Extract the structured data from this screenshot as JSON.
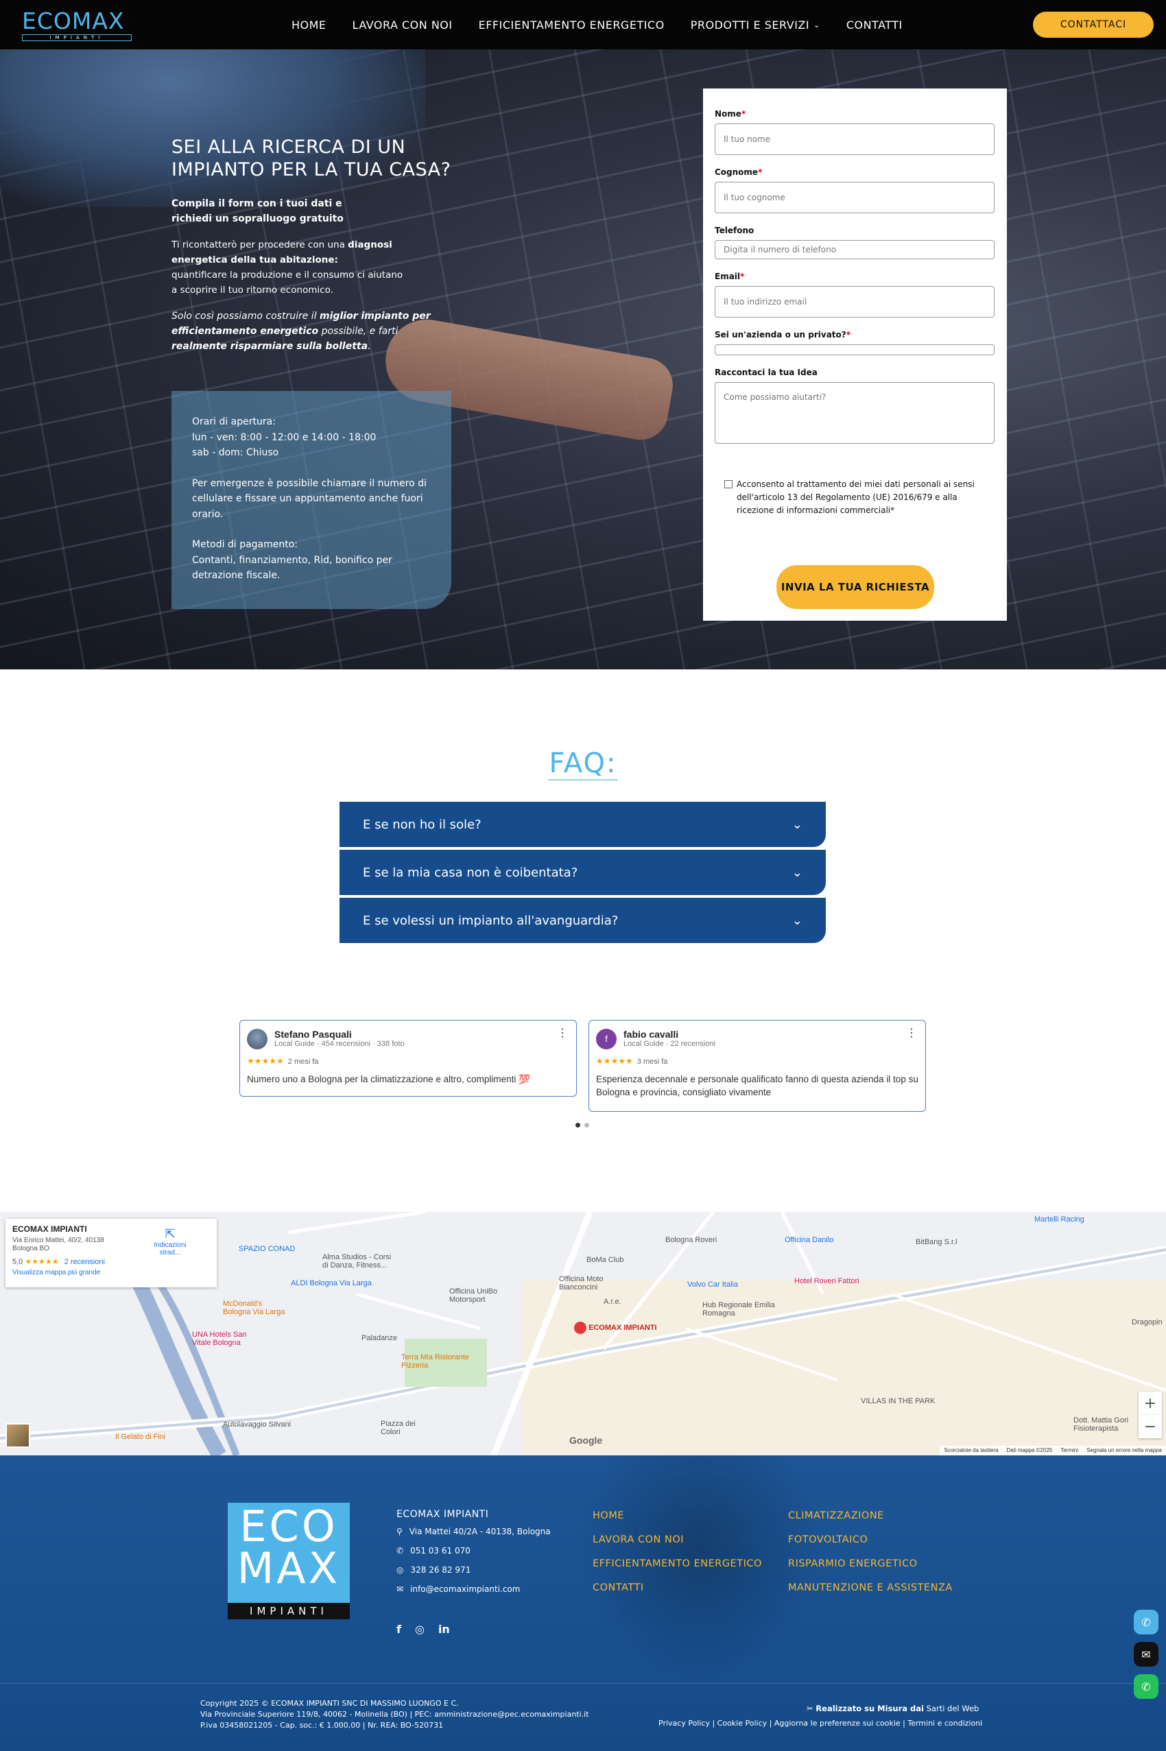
{
  "header": {
    "logo_text": "ECOMAX",
    "logo_sub": "IMPIANTI",
    "nav": [
      "HOME",
      "LAVORA CON NOI",
      "EFFICIENTAMENTO ENERGETICO",
      "PRODOTTI E SERVIZI",
      "CONTATTI"
    ],
    "cta": "CONTATTACI"
  },
  "hero": {
    "title": "SEI ALLA RICERCA DI UN IMPIANTO PER LA TUA CASA?",
    "p1": "Compila il form con i tuoi dati e richiedi un sopralluogo gratuito",
    "p2_a": "Ti ricontatterò per procedere con una ",
    "p2_b": "diagnosi energetica della tua abitazione:",
    "p2_c": "quantificare la produzione e il consumo ci aiutano a scoprire il tuo ritorno economico.",
    "p3_a": "Solo così possiamo costruire il ",
    "p3_b": "miglior impianto per efficientamento energetico",
    "p3_c": " possibile, e farti ",
    "p3_d": "realmente risparmiare sulla bolletta",
    "p3_e": ".",
    "hours_1": "Orari di apertura:",
    "hours_2": "lun - ven: 8:00 - 12:00 e 14:00 - 18:00",
    "hours_3": "sab - dom: Chiuso",
    "hours_4": "Per emergenze è possibile chiamare il numero di cellulare e fissare un appuntamento anche fuori orario.",
    "hours_5": "Metodi di pagamento:",
    "hours_6": "Contanti, finanziamento, Rid, bonifico per detrazione fiscale."
  },
  "form": {
    "nome_label": "Nome",
    "nome_ph": "Il tuo nome",
    "cognome_label": "Cognome",
    "cognome_ph": "Il tuo cognome",
    "tel_label": "Telefono",
    "tel_ph": "Digita il numero di telefono",
    "email_label": "Email",
    "email_ph": "Il tuo indirizzo email",
    "tipo_label": "Sei un'azienda o un privato?",
    "idea_label": "Raccontaci la tua Idea",
    "idea_ph": "Come possiamo aiutarti?",
    "consent": "Acconsento al trattamento dei miei dati personali ai sensi dell'articolo 13 del Regolamento (UE) 2016/679 e alla ricezione di informazioni commerciali*",
    "submit": "INVIA LA TUA RICHIESTA",
    "required_mark": "*"
  },
  "faq": {
    "title": "FAQ:",
    "items": [
      "E se non ho il sole?",
      "E se la mia casa non è coibentata?",
      "E se volessi un impianto all'avanguardia?"
    ]
  },
  "reviews": [
    {
      "name": "Stefano Pasquali",
      "sub": "Local Guide · 454 recensioni · 338 foto",
      "when": "2 mesi fa",
      "text": "Numero uno a Bologna per la climatizzazione e altro, complimenti 💯"
    },
    {
      "name": "fabio cavalli",
      "sub": "Local Guide · 22 recensioni",
      "when": "3 mesi fa",
      "text": "Esperienza decennale e personale qualificato fanno di questa azienda il top su Bologna e provincia, consigliato vivamente"
    }
  ],
  "map": {
    "card_title": "ECOMAX IMPIANTI",
    "card_address": "Via Enrico Mattei, 40/2, 40138 Bologna BO",
    "rating": "5,0",
    "reviews_link": "2 recensioni",
    "bigger_map": "Visualizza mappa più grande",
    "directions": "Indicazioni strad...",
    "pin_label": "ECOMAX IMPIANTI",
    "labels": [
      "Bologna Roveri",
      "Officina Danilo",
      "BitBang S.r.l",
      "Martelli Racing",
      "SPAZIO CONAD",
      "Alma Studios - Corsi di Danza, Fitness...",
      "ALDI Bologna Via Larga",
      "Officina UniBo Motorsport",
      "Officina Moto Bianconcini",
      "BoMa Club",
      "A.r.e.",
      "Volvo Car Italia",
      "Hotel Roveri Fattori",
      "Hub Regionale Emilia Romagna",
      "McDonald's Bologna Via Larga",
      "UNA Hotels San Vitale Bologna",
      "Paladanze",
      "Terra Mia Ristorante Pizzeria",
      "Via Enrico Mattei",
      "VILLAS IN THE PARK",
      "Autolavaggio Silvani",
      "Piazza dei Colori",
      "Il Gelato di Fini",
      "Dott. Mattia Gori Fisioterapista",
      "Dragopin"
    ],
    "google": "Google",
    "attrib": [
      "Scorciatoie da tastiera",
      "Dati mappa ©2025",
      "Termini",
      "Segnala un errore nella mappa"
    ]
  },
  "footer": {
    "logo_eco": "ECO",
    "logo_max": "MAX",
    "logo_imp": "IMPIANTI",
    "company": "ECOMAX IMPIANTI",
    "address": "Via Mattei 40/2A - 40138, Bologna",
    "phone1": "051 03 61 070",
    "phone2": "328 26 82 971",
    "email": "info@ecomaximpianti.com",
    "links1": [
      "HOME",
      "LAVORA CON NOI",
      "EFFICIENTAMENTO ENERGETICO",
      "CONTATTI"
    ],
    "links2": [
      "CLIMATIZZAZIONE",
      "FOTOVOLTAICO",
      "RISPARMIO ENERGETICO",
      "MANUTENZIONE E ASSISTENZA"
    ],
    "copy1": "Copyright 2025 © ECOMAX IMPIANTI SNC DI MASSIMO LUONGO E C.",
    "copy2": "Via Provinciale Superiore 119/8, 40062 - Molinella (BO) | PEC: amministrazione@pec.ecomaximpianti.it",
    "copy3": "P.iva 03458021205 - Cap. soc.: € 1.000,00 | Nr. REA: BO-520731",
    "credit_a": "Realizzato su Misura dai",
    "credit_b": "Sarti del Web",
    "legal": "Privacy Policy | Cookie Policy | Aggiorna le preferenze sui cookie | Termini e condizioni"
  },
  "colors": {
    "accent": "#4fb4e8",
    "cta": "#f7b733",
    "navy": "#174c8c",
    "footer": "#1d5596"
  }
}
